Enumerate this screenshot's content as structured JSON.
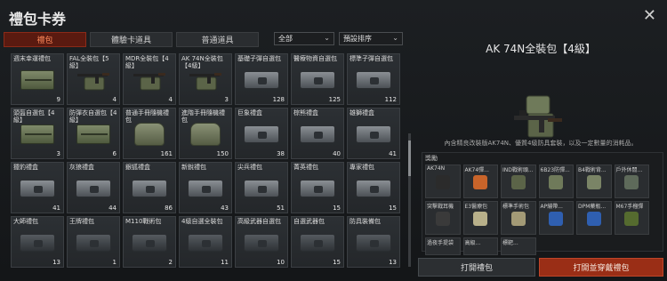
{
  "window": {
    "title": "禮包卡券"
  },
  "tabs": [
    {
      "label": "禮包",
      "active": true
    },
    {
      "label": "體驗卡道具",
      "active": false
    },
    {
      "label": "普通道具",
      "active": false
    }
  ],
  "filters": {
    "category": "全部",
    "sort": "預設排序"
  },
  "items": [
    {
      "name": "週末幸運禮包",
      "count": "9",
      "art": "crate"
    },
    {
      "name": "FAL全裝包【5級】",
      "count": "4",
      "art": "gunbox"
    },
    {
      "name": "MDR全裝包【4級】",
      "count": "4",
      "art": "gunbox"
    },
    {
      "name": "AK 74N全裝包【4級】",
      "count": "3",
      "art": "gunbox"
    },
    {
      "name": "基礎子彈自選包",
      "count": "128",
      "art": "case"
    },
    {
      "name": "醫療物資自選包",
      "count": "125",
      "art": "case"
    },
    {
      "name": "標準子彈自選包",
      "count": "112",
      "art": "case"
    },
    {
      "name": "頭盔自選包【4級】",
      "count": "3",
      "art": "crate"
    },
    {
      "name": "防彈衣自選包【4級】",
      "count": "6",
      "art": "crate"
    },
    {
      "name": "普通手冊隨機禮包",
      "count": "161",
      "art": "bag"
    },
    {
      "name": "進階手冊隨機禮包",
      "count": "150",
      "art": "bag"
    },
    {
      "name": "巨象禮盒",
      "count": "38",
      "art": "case"
    },
    {
      "name": "棕熊禮盒",
      "count": "40",
      "art": "case"
    },
    {
      "name": "雄獅禮盒",
      "count": "41",
      "art": "case"
    },
    {
      "name": "獵豹禮盒",
      "count": "41",
      "art": "case"
    },
    {
      "name": "灰狼禮盒",
      "count": "44",
      "art": "case"
    },
    {
      "name": "銀狐禮盒",
      "count": "86",
      "art": "case"
    },
    {
      "name": "新銳禮包",
      "count": "43",
      "art": "case"
    },
    {
      "name": "尖兵禮包",
      "count": "51",
      "art": "case"
    },
    {
      "name": "菁英禮包",
      "count": "15",
      "art": "case"
    },
    {
      "name": "專家禮包",
      "count": "15",
      "art": "case"
    },
    {
      "name": "大師禮包",
      "count": "13",
      "art": "dark"
    },
    {
      "name": "王牌禮包",
      "count": "1",
      "art": "dark"
    },
    {
      "name": "M110戰術包",
      "count": "2",
      "art": "dark"
    },
    {
      "name": "4級自選全裝包",
      "count": "11",
      "art": "dark"
    },
    {
      "name": "高級武器自選包",
      "count": "10",
      "art": "dark"
    },
    {
      "name": "自選武器包",
      "count": "15",
      "art": "dark"
    },
    {
      "name": "防具裝備包",
      "count": "13",
      "art": "dark"
    }
  ],
  "detail": {
    "title": "AK 74N全裝包【4級】",
    "description": "內含精良改裝版AK74N、優質4級防具套裝，以及一定數量的消耗品。",
    "contents_label": "獎勵",
    "contents": [
      {
        "name": "AK74N"
      },
      {
        "name": "AK74彈..."
      },
      {
        "name": "IND戰術頭..."
      },
      {
        "name": "6B23防彈..."
      },
      {
        "name": "B4戰術背..."
      },
      {
        "name": "戶外休閒..."
      },
      {
        "name": "突擊戰耳機"
      },
      {
        "name": "E3醫療包"
      },
      {
        "name": "標準手術包"
      },
      {
        "name": "AP繃帶..."
      },
      {
        "name": "DPM藥瓶..."
      },
      {
        "name": "M67手榴彈"
      },
      {
        "name": "過夜手提袋"
      },
      {
        "name": "高級..."
      },
      {
        "name": "標靶..."
      }
    ]
  },
  "buttons": {
    "open": "打開禮包",
    "open_equip": "打開並穿戴禮包"
  }
}
